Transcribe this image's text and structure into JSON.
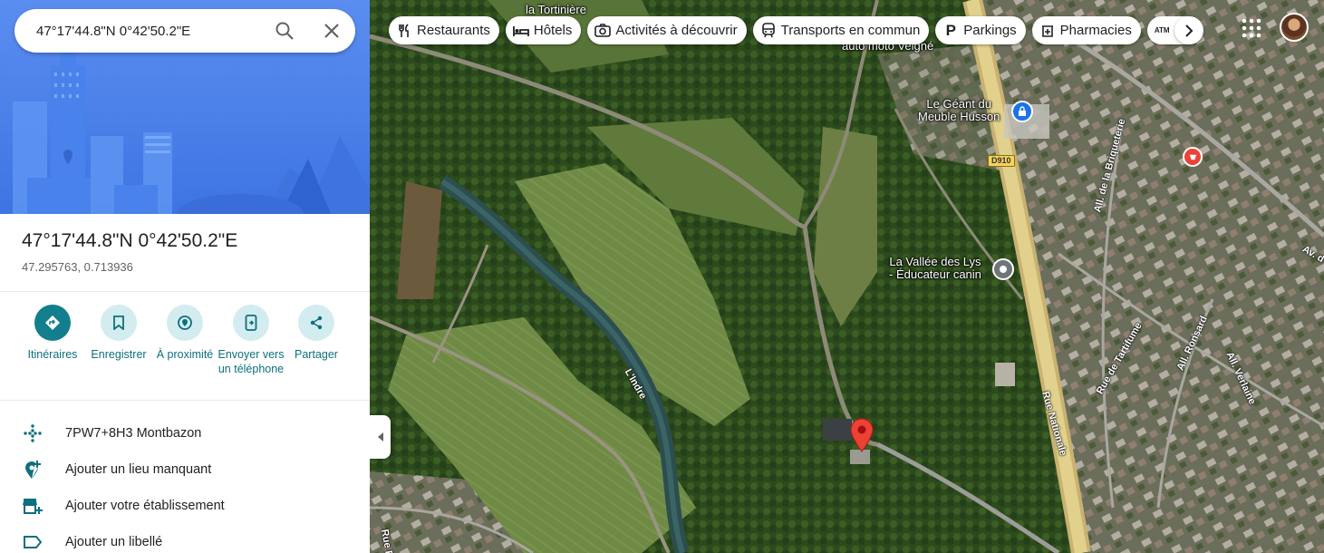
{
  "search": {
    "value": "47°17'44.8\"N 0°42'50.2\"E",
    "search_icon": "search-icon",
    "clear_icon": "close-icon"
  },
  "place": {
    "title": "47°17'44.8\"N 0°42'50.2\"E",
    "coords": "47.295763, 0.713936"
  },
  "actions": [
    {
      "label": "Itinéraires",
      "icon": "directions-icon"
    },
    {
      "label": "Enregistrer",
      "icon": "bookmark-icon"
    },
    {
      "label": "À proximité",
      "icon": "nearby-icon"
    },
    {
      "label": "Envoyer vers un téléphone",
      "icon": "send-to-phone-icon"
    },
    {
      "label": "Partager",
      "icon": "share-icon"
    }
  ],
  "info_rows": [
    {
      "label": "7PW7+8H3 Montbazon",
      "icon": "plus-code-icon"
    },
    {
      "label": "Ajouter un lieu manquant",
      "icon": "add-place-icon"
    },
    {
      "label": "Ajouter votre établissement",
      "icon": "add-business-icon"
    },
    {
      "label": "Ajouter un libellé",
      "icon": "label-icon"
    }
  ],
  "chips": [
    {
      "label": "Restaurants",
      "icon": "restaurant-icon"
    },
    {
      "label": "Hôtels",
      "icon": "hotel-icon"
    },
    {
      "label": "Activités à découvrir",
      "icon": "camera-icon"
    },
    {
      "label": "Transports en commun",
      "icon": "transit-icon"
    },
    {
      "label": "Parkings",
      "icon": "parking-icon"
    },
    {
      "label": "Pharmacies",
      "icon": "pharmacy-icon"
    },
    {
      "label": "ATM",
      "icon": "atm-icon"
    }
  ],
  "map_labels": {
    "tortiniere": "la Tortinière",
    "auto_moto": "auto moto Veigné",
    "geant_line1": "Le Géant du",
    "geant_line2": "Meuble Husson",
    "vallee_line1": "La Vallée des Lys",
    "vallee_line2": "- Éducateur canin",
    "river": "L'Indre",
    "road_badge": "D910",
    "rue_nationale": "Rue Nationale",
    "briqueterie": "All. de la Briqueterie",
    "tartifume": "Rue de Tartifume",
    "ronsard": "All. Ronsard",
    "verlaine": "All. Verlaine",
    "av": "Av. d",
    "rue_f": "Rue F"
  },
  "colors": {
    "accent_teal": "#137e8d",
    "hero_blue": "#4a7fe8",
    "pin_red": "#ea4335"
  }
}
